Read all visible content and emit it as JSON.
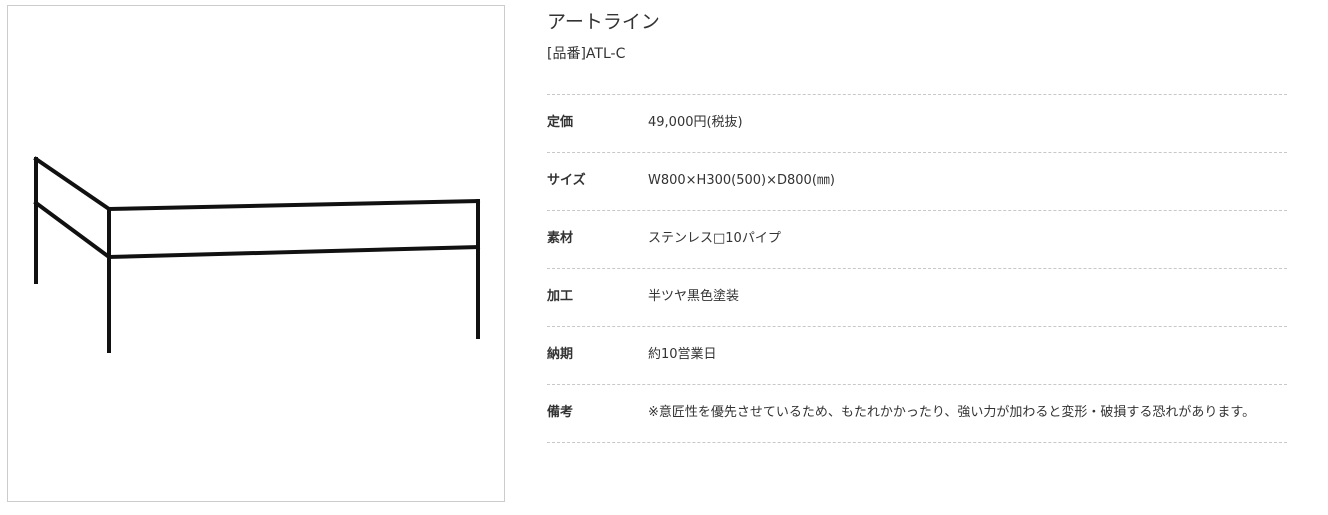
{
  "product": {
    "title": "アートライン",
    "code": "[品番]ATL-C",
    "image_alt": "ATL-C steel frame product image"
  },
  "specs": [
    {
      "label": "定価",
      "value": "49,000円(税抜)"
    },
    {
      "label": "サイズ",
      "value": "W800×H300(500)×D800(㎜)"
    },
    {
      "label": "素材",
      "value": "ステンレス□10パイプ"
    },
    {
      "label": "加工",
      "value": "半ツヤ黒色塗装"
    },
    {
      "label": "納期",
      "value": "約10営業日"
    },
    {
      "label": "備考",
      "value": "※意匠性を優先させているため、もたれかかったり、強い力が加わると変形・破損する恐れがあります。"
    }
  ],
  "colors": {
    "frame": "#111111",
    "border": "#cccccc",
    "divider": "#c8c8c8",
    "text": "#333333"
  }
}
